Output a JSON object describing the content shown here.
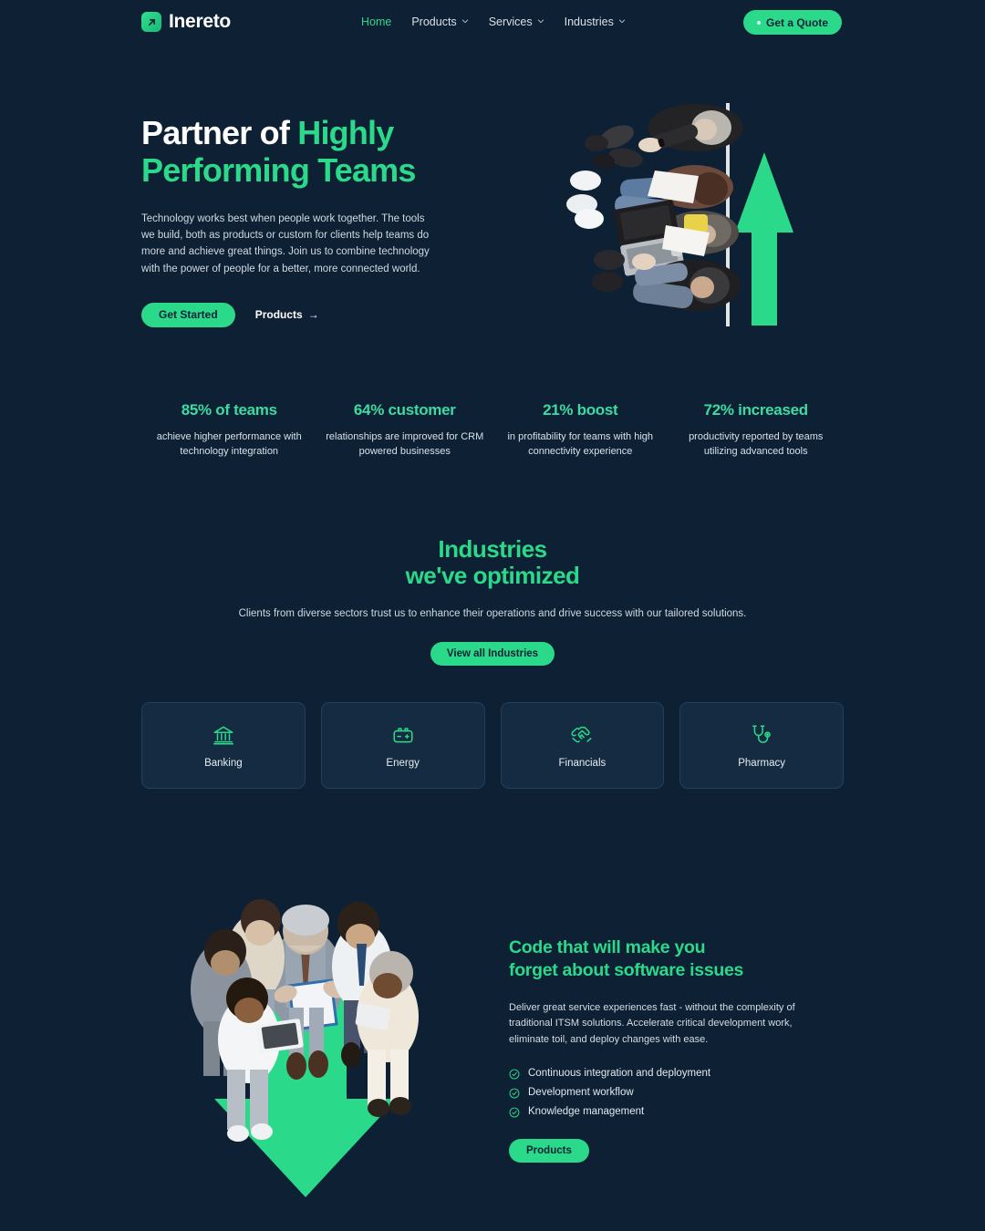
{
  "header": {
    "logo_text": "Inereto",
    "logo_icon": "arrow-logo-icon",
    "nav": [
      {
        "label": "Home",
        "active": true,
        "caret": false
      },
      {
        "label": "Products",
        "active": false,
        "caret": true
      },
      {
        "label": "Services",
        "active": false,
        "caret": true
      },
      {
        "label": "Industries",
        "active": false,
        "caret": true
      }
    ],
    "quote_button": "Get a Quote"
  },
  "hero": {
    "title_line1_white": "Partner of ",
    "title_line1_accent": "Highly",
    "title_line2_accent": "Performing Teams",
    "paragraph": "Technology works best when people work together. The tools we build, both as products or custom for clients help teams do more and achieve great things. Join us to combine technology with the power of people for a better, more connected world.",
    "primary_button": "Get Started",
    "secondary_link": "Products",
    "secondary_link_arrow": "→",
    "image_alt": "team-meeting-top-down-photo"
  },
  "stats": [
    {
      "value": "85% of teams",
      "desc": "achieve higher performance with technology integration"
    },
    {
      "value": "64% customer",
      "desc": "relationships are improved for CRM powered businesses"
    },
    {
      "value": "21% boost",
      "desc": "in profitability for teams with high connectivity experience"
    },
    {
      "value": "72% increased",
      "desc": "productivity reported by teams utilizing advanced tools"
    }
  ],
  "industries": {
    "title_line1": "Industries",
    "title_line2": "we've optimized",
    "subtitle": "Clients from diverse sectors trust us to enhance their operations and drive success with our tailored solutions.",
    "button": "View all Industries",
    "cards": [
      {
        "label": "Banking",
        "icon": "bank-icon"
      },
      {
        "label": "Energy",
        "icon": "battery-icon"
      },
      {
        "label": "Financials",
        "icon": "handshake-icon"
      },
      {
        "label": "Pharmacy",
        "icon": "stethoscope-icon"
      }
    ]
  },
  "code_section": {
    "title_line1": "Code that will make you",
    "title_line2": "forget about software issues",
    "paragraph": "Deliver great service experiences fast - without the complexity of traditional ITSM solutions. Accelerate critical development work, eliminate toil, and deploy changes with ease.",
    "features": [
      "Continuous integration and deployment",
      "Development workflow",
      "Knowledge management"
    ],
    "button": "Products",
    "image_alt": "business-team-circle-top-down-photo"
  },
  "colors": {
    "background": "#0e2033",
    "card": "#152b41",
    "accent_green": "#2bd98a",
    "stat_green": "#3ddba3",
    "text_primary": "#ffffff",
    "text_muted": "#cfdae4"
  }
}
